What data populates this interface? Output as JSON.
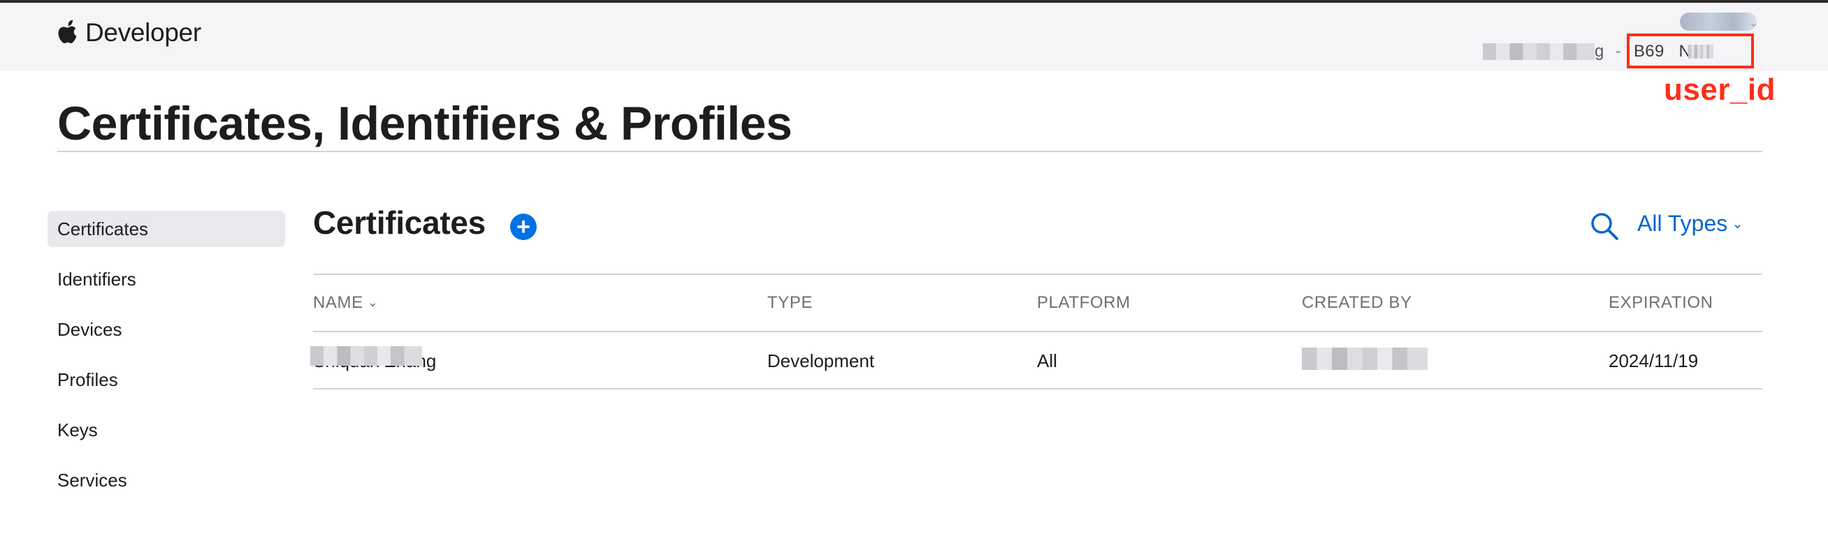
{
  "globalnav": {
    "brand": "Developer",
    "account_menu_chevron": "⌄",
    "team_name_visible_tail": "g",
    "team_separator": "-",
    "team_id": "B69   N26"
  },
  "annotation": {
    "label": "user_id",
    "color": "#ff2d1a"
  },
  "page": {
    "title": "Certificates, Identifiers & Profiles"
  },
  "sidebar": {
    "items": [
      {
        "label": "Certificates",
        "active": true
      },
      {
        "label": "Identifiers",
        "active": false
      },
      {
        "label": "Devices",
        "active": false
      },
      {
        "label": "Profiles",
        "active": false
      },
      {
        "label": "Keys",
        "active": false
      },
      {
        "label": "Services",
        "active": false
      }
    ]
  },
  "main": {
    "section_title": "Certificates",
    "add_button_icon": "+",
    "search_icon": "magnifying-glass",
    "filter_label": "All Types",
    "filter_chevron": "⌄",
    "table": {
      "columns": [
        {
          "label": "NAME",
          "sort_chevron": "⌄"
        },
        {
          "label": "TYPE"
        },
        {
          "label": "PLATFORM"
        },
        {
          "label": "CREATED BY"
        },
        {
          "label": "EXPIRATION"
        }
      ],
      "rows": [
        {
          "name": "Shiquan Zhang",
          "type": "Development",
          "platform": "All",
          "created_by": "",
          "expiration": "2024/11/19"
        }
      ]
    }
  },
  "colors": {
    "accent": "#0071e3",
    "link": "#0066cc",
    "nav_background": "#f5f5f7",
    "annotation": "#ff2d1a"
  }
}
